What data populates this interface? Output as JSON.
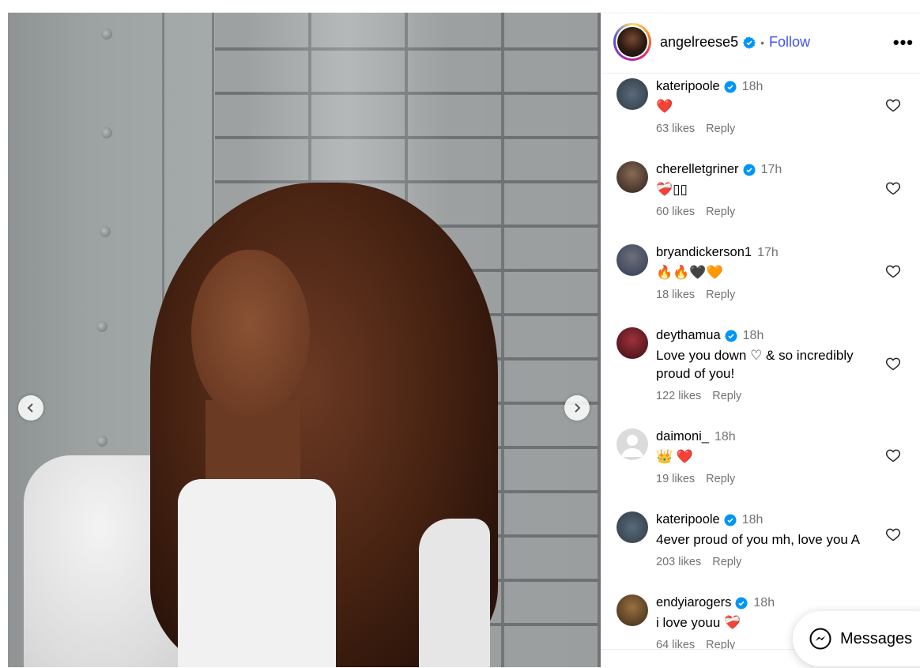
{
  "post": {
    "author": "angelreese5",
    "separator": "•",
    "follow_label": "Follow",
    "more_label": "•••"
  },
  "icons": {
    "verified": "verified-badge-icon",
    "heart": "heart-outline-icon",
    "prev": "chevron-left-icon",
    "next": "chevron-right-icon",
    "messenger": "messenger-icon"
  },
  "colors": {
    "accent": "#4150f7",
    "verified": "#0095f6",
    "muted": "#737373"
  },
  "comments": [
    {
      "user": "kateripoole",
      "time": "18h",
      "text": "❤️",
      "likes": "63 likes",
      "reply": "Reply"
    },
    {
      "user": "cherelletgriner",
      "time": "17h",
      "text": "❤️‍🩹▯▯",
      "likes": "60 likes",
      "reply": "Reply"
    },
    {
      "user": "bryandickerson1",
      "time": "17h",
      "text": "🔥🔥🖤🧡",
      "likes": "18 likes",
      "reply": "Reply"
    },
    {
      "user": "deythamua",
      "time": "18h",
      "text": "Love you down ♡ & so incredibly proud of you!",
      "likes": "122 likes",
      "reply": "Reply"
    },
    {
      "user": "daimoni_",
      "time": "18h",
      "text": "👑 ❤️",
      "likes": "19 likes",
      "reply": "Reply"
    },
    {
      "user": "kateripoole",
      "time": "18h",
      "text": "4ever proud of you mh, love you A",
      "likes": "203 likes",
      "reply": "Reply"
    },
    {
      "user": "endyiarogers",
      "time": "18h",
      "text": "i love youu ❤️‍🩹",
      "likes": "64 likes",
      "reply": "Reply"
    }
  ],
  "messages_label": "Messages"
}
